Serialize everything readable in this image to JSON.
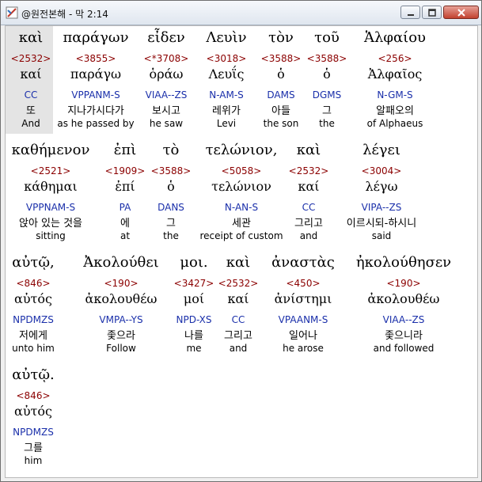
{
  "window": {
    "title": "@원전본해 - 막 2:14",
    "colors": {
      "strongs": "#8b0000",
      "parsing": "#1a2faa",
      "text": "#000000"
    }
  },
  "rows": [
    {
      "words": [
        {
          "greek": "καὶ",
          "strongs": "<2532>",
          "lemma": "καί",
          "parsing": "CC",
          "korean": "또",
          "english": "And"
        },
        {
          "greek": "παράγων",
          "strongs": "<3855>",
          "lemma": "παράγω",
          "parsing": "VPPANM-S",
          "korean": "지나가시다가",
          "english": "as he passed by"
        },
        {
          "greek": "εἶδεν",
          "strongs": "<*3708>",
          "lemma": "ὁράω",
          "parsing": "VIAA--ZS",
          "korean": "보시고",
          "english": "he saw"
        },
        {
          "greek": "Λευὶν",
          "strongs": "<3018>",
          "lemma": "Λευΐς",
          "parsing": "N-AM-S",
          "korean": "레위가",
          "english": "Levi"
        },
        {
          "greek": "τὸν",
          "strongs": "<3588>",
          "lemma": "ὁ",
          "parsing": "DAMS",
          "korean": "아들",
          "english": "the son"
        },
        {
          "greek": "τοῦ",
          "strongs": "<3588>",
          "lemma": "ὁ",
          "parsing": "DGMS",
          "korean": "그",
          "english": "the"
        },
        {
          "greek": "Ἁλφαίου",
          "strongs": "<256>",
          "lemma": "Ἀλφαῖος",
          "parsing": "N-GM-S",
          "korean": "알패오의",
          "english": "of Alphaeus"
        }
      ]
    },
    {
      "words": [
        {
          "greek": "καθήμενον",
          "strongs": "<2521>",
          "lemma": "κάθημαι",
          "parsing": "VPPNAM-S",
          "korean": "앉아 있는 것을",
          "english": "sitting"
        },
        {
          "greek": "ἐπὶ",
          "strongs": "<1909>",
          "lemma": "ἐπί",
          "parsing": "PA",
          "korean": "에",
          "english": "at"
        },
        {
          "greek": "τὸ",
          "strongs": "<3588>",
          "lemma": "ὁ",
          "parsing": "DANS",
          "korean": "그",
          "english": "the"
        },
        {
          "greek": "τελώνιον,",
          "strongs": "<5058>",
          "lemma": "τελώνιον",
          "parsing": "N-AN-S",
          "korean": "세관",
          "english": "receipt of custom"
        },
        {
          "greek": "καὶ",
          "strongs": "<2532>",
          "lemma": "καί",
          "parsing": "CC",
          "korean": "그리고",
          "english": "and"
        },
        {
          "greek": "λέγει",
          "strongs": "<3004>",
          "lemma": "λέγω",
          "parsing": "VIPA--ZS",
          "korean": "이르시되-하시니",
          "english": "said"
        }
      ]
    },
    {
      "words": [
        {
          "greek": "αὐτῷ,",
          "strongs": "<846>",
          "lemma": "αὐτός",
          "parsing": "NPDMZS",
          "korean": "저에게",
          "english": "unto him"
        },
        {
          "greek": "Ἀκολούθει",
          "strongs": "<190>",
          "lemma": "ἀκολουθέω",
          "parsing": "VMPA--YS",
          "korean": "좇으라",
          "english": "Follow"
        },
        {
          "greek": "μοι.",
          "strongs": "<3427>",
          "lemma": "μοί",
          "parsing": "NPD-XS",
          "korean": "나를",
          "english": "me"
        },
        {
          "greek": "καὶ",
          "strongs": "<2532>",
          "lemma": "καί",
          "parsing": "CC",
          "korean": "그리고",
          "english": "and"
        },
        {
          "greek": "ἀναστὰς",
          "strongs": "<450>",
          "lemma": "ἀνίστημι",
          "parsing": "VPAANM-S",
          "korean": "일어나",
          "english": "he arose"
        },
        {
          "greek": "ἠκολούθησεν",
          "strongs": "<190>",
          "lemma": "ἀκολουθέω",
          "parsing": "VIAA--ZS",
          "korean": "좇으니라",
          "english": "and followed"
        }
      ]
    },
    {
      "words": [
        {
          "greek": "αὐτῷ.",
          "strongs": "<846>",
          "lemma": "αὐτός",
          "parsing": "NPDMZS",
          "korean": "그를",
          "english": "him"
        }
      ]
    }
  ]
}
